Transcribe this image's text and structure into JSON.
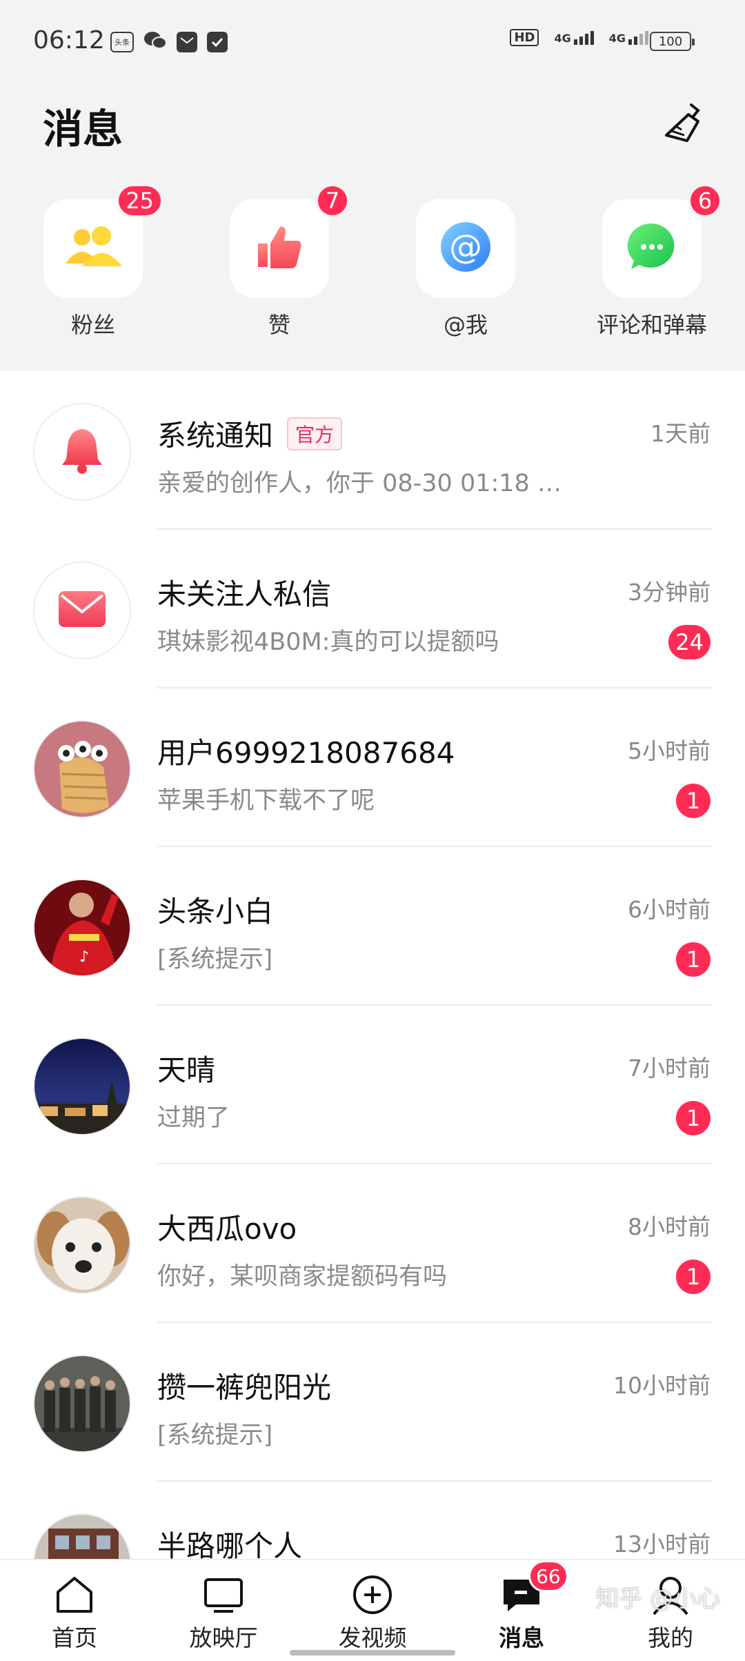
{
  "status_bar": {
    "time": "06:12",
    "left_icons": [
      "toutiao-icon",
      "wechat-icon",
      "mail-icon",
      "clipboard-icon"
    ],
    "hd_label": "HD",
    "network_1": "4G",
    "network_2": "4G",
    "battery": "100"
  },
  "header": {
    "title": "消息",
    "clean_icon": "broom-icon"
  },
  "quick": [
    {
      "label": "粉丝",
      "badge": "25",
      "icon": "fans-icon"
    },
    {
      "label": "赞",
      "badge": "7",
      "icon": "thumbs-up-icon"
    },
    {
      "label": "@我",
      "badge": "",
      "icon": "at-icon"
    },
    {
      "label": "评论和弹幕",
      "badge": "6",
      "icon": "comment-bubble-icon"
    }
  ],
  "messages": [
    {
      "name": "系统通知",
      "tag": "官方",
      "preview": "亲爱的创作人，你于 08-30 01:18 …",
      "time": "1天前",
      "badge": "",
      "avatar": "bell-icon"
    },
    {
      "name": "未关注人私信",
      "tag": "",
      "preview": "琪妹影视4B0M:真的可以提额吗",
      "time": "3分钟前",
      "badge": "24",
      "avatar": "envelope-icon"
    },
    {
      "name": "用户6999218087684",
      "tag": "",
      "preview": "苹果手机下载不了呢",
      "time": "5小时前",
      "badge": "1",
      "avatar": "cartoon-avatar"
    },
    {
      "name": "头条小白",
      "tag": "",
      "preview": "[系统提示]",
      "time": "6小时前",
      "badge": "1",
      "avatar": "red-jersey-avatar"
    },
    {
      "name": "天晴",
      "tag": "",
      "preview": "过期了",
      "time": "7小时前",
      "badge": "1",
      "avatar": "night-city-avatar"
    },
    {
      "name": "大西瓜ovo",
      "tag": "",
      "preview": "你好，某呗商家提额码有吗",
      "time": "8小时前",
      "badge": "1",
      "avatar": "puppy-avatar"
    },
    {
      "name": "攒一裤兜阳光",
      "tag": "",
      "preview": "[系统提示]",
      "time": "10小时前",
      "badge": "",
      "avatar": "group-photo-avatar"
    },
    {
      "name": "半路哪个人",
      "tag": "",
      "preview": "",
      "time": "13小时前",
      "badge": "",
      "avatar": "building-avatar"
    }
  ],
  "bottom_nav": [
    {
      "label": "首页",
      "icon": "home-icon",
      "badge": ""
    },
    {
      "label": "放映厅",
      "icon": "tv-icon",
      "badge": ""
    },
    {
      "label": "发视频",
      "icon": "plus-circle-icon",
      "badge": ""
    },
    {
      "label": "消息",
      "icon": "message-icon",
      "badge": "66"
    },
    {
      "label": "我的",
      "icon": "person-icon",
      "badge": ""
    }
  ],
  "watermark": "知乎 @小心",
  "colors": {
    "accent": "#fe2c55",
    "header_bg": "#f3f3f3"
  }
}
